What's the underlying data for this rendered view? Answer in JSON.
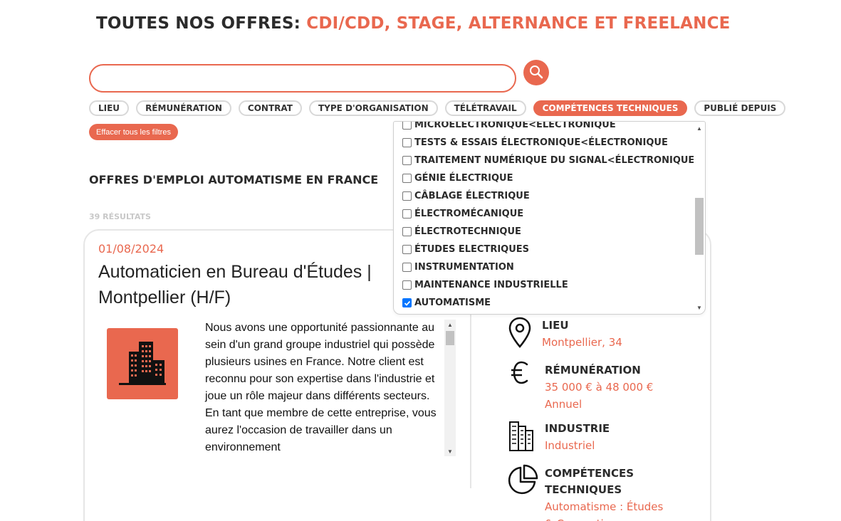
{
  "header": {
    "title_prefix": "TOUTES NOS OFFRES:",
    "title_accent": "CDI/CDD, STAGE, ALTERNANCE ET FREELANCE"
  },
  "search": {
    "value": "",
    "placeholder": "",
    "button_icon": "search-icon"
  },
  "filters": [
    {
      "label": "LIEU",
      "active": false
    },
    {
      "label": "RÉMUNÉRATION",
      "active": false
    },
    {
      "label": "CONTRAT",
      "active": false
    },
    {
      "label": "TYPE D'ORGANISATION",
      "active": false
    },
    {
      "label": "TÉLÉTRAVAIL",
      "active": false
    },
    {
      "label": "COMPÉTENCES TECHNIQUES",
      "active": true
    },
    {
      "label": "PUBLIÉ DEPUIS",
      "active": false
    }
  ],
  "clear_filters_label": "Effacer tous les filtres",
  "section_title": "OFFRES D'EMPLOI AUTOMATISME EN FRANCE",
  "results_count": "39 RÉSULTATS",
  "dropdown": {
    "items": [
      {
        "label": "MICROELECTRONIQUE<ELECTRONIQUE",
        "checked": false
      },
      {
        "label": "TESTS & ESSAIS ÉLECTRONIQUE<ÉLECTRONIQUE",
        "checked": false
      },
      {
        "label": "TRAITEMENT NUMÉRIQUE DU SIGNAL<ÉLECTRONIQUE",
        "checked": false
      },
      {
        "label": "GÉNIE ÉLECTRIQUE",
        "checked": false
      },
      {
        "label": "CÂBLAGE ÉLECTRIQUE",
        "checked": false
      },
      {
        "label": "ÉLECTROMÉCANIQUE",
        "checked": false
      },
      {
        "label": "ÉLECTROTECHNIQUE",
        "checked": false
      },
      {
        "label": "ÉTUDES ELECTRIQUES",
        "checked": false
      },
      {
        "label": "INSTRUMENTATION",
        "checked": false
      },
      {
        "label": "MAINTENANCE INDUSTRIELLE",
        "checked": false
      },
      {
        "label": "AUTOMATISME",
        "checked": true
      }
    ]
  },
  "job": {
    "date": "01/08/2024",
    "title": "Automaticien en Bureau d'Études | Montpellier (H/F)",
    "logo_icon": "building-icon",
    "description": "Nous avons une opportunité passionnante au sein d'un grand groupe industriel qui possède plusieurs usines en France. Notre client est reconnu pour son expertise dans l'industrie et joue un rôle majeur dans différents secteurs. En tant que membre de cette entreprise, vous aurez l'occasion de travailler dans un environnement",
    "details": {
      "location_label": "LIEU",
      "location_value": "Montpellier, 34",
      "salary_label": "RÉMUNÉRATION",
      "salary_value": "35 000 € à 48 000 €",
      "salary_period": "Annuel",
      "industry_label": "INDUSTRIE",
      "industry_value": "Industriel",
      "skills_label_1": "COMPÉTENCES",
      "skills_label_2": "TECHNIQUES",
      "skills_value_1": "Automatisme : Études",
      "skills_value_2": "& Conception"
    }
  },
  "colors": {
    "accent": "#e9684f",
    "text_dark": "#2b2b2b",
    "border_light": "#e6e6e6",
    "checkbox_checked": "#0075ff"
  }
}
